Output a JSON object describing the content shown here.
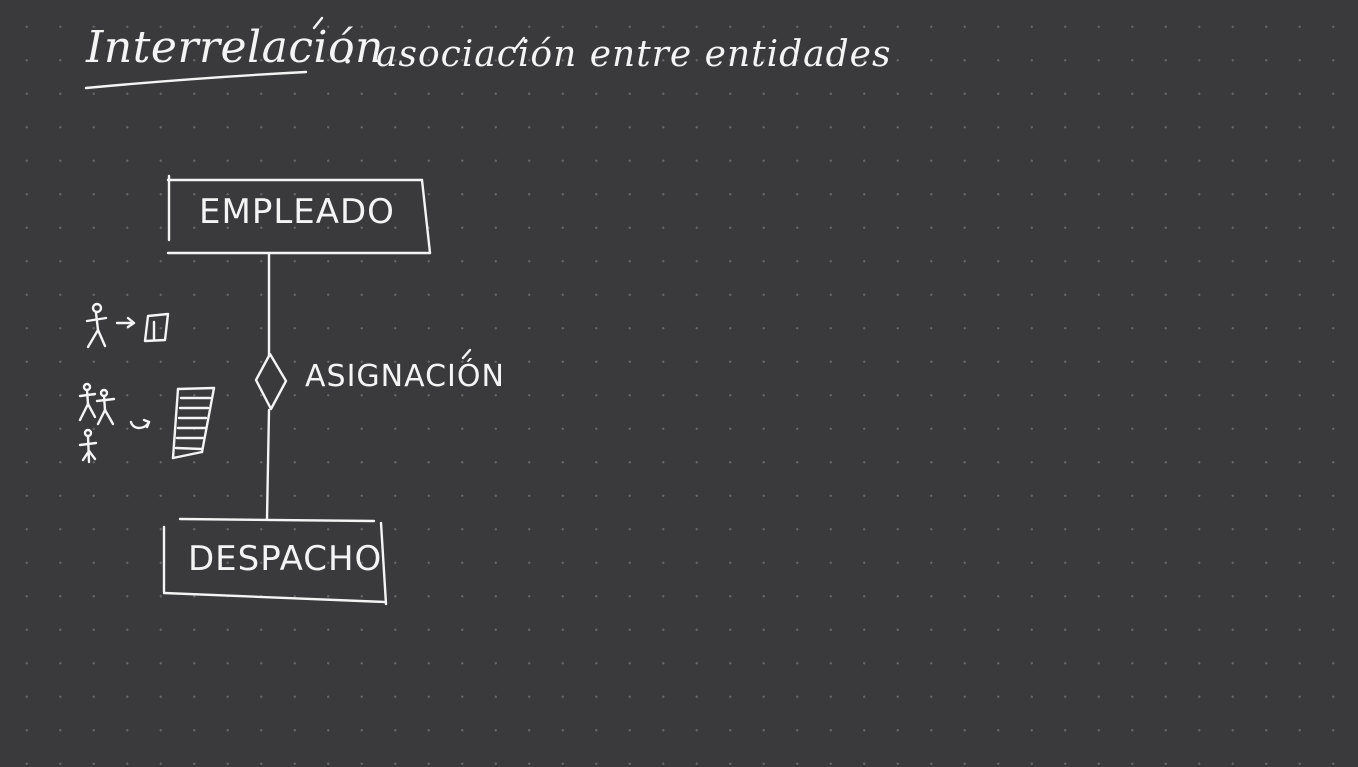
{
  "title": {
    "term": "Interrelación",
    "separator": ":",
    "definition": "asociación entre entidades"
  },
  "diagram": {
    "entity_top": "EMPLEADO",
    "relationship": "ASIGNACIÓN",
    "entity_bottom": "DESPACHO"
  },
  "colors": {
    "background": "#3a393c",
    "ink": "#f4f4f4",
    "grid_dot": "#5a595c"
  },
  "icons": [
    "person-icon",
    "arrow-right-icon",
    "office-icon",
    "people-group-icon",
    "curved-arrow-icon",
    "ladder-list-icon"
  ]
}
